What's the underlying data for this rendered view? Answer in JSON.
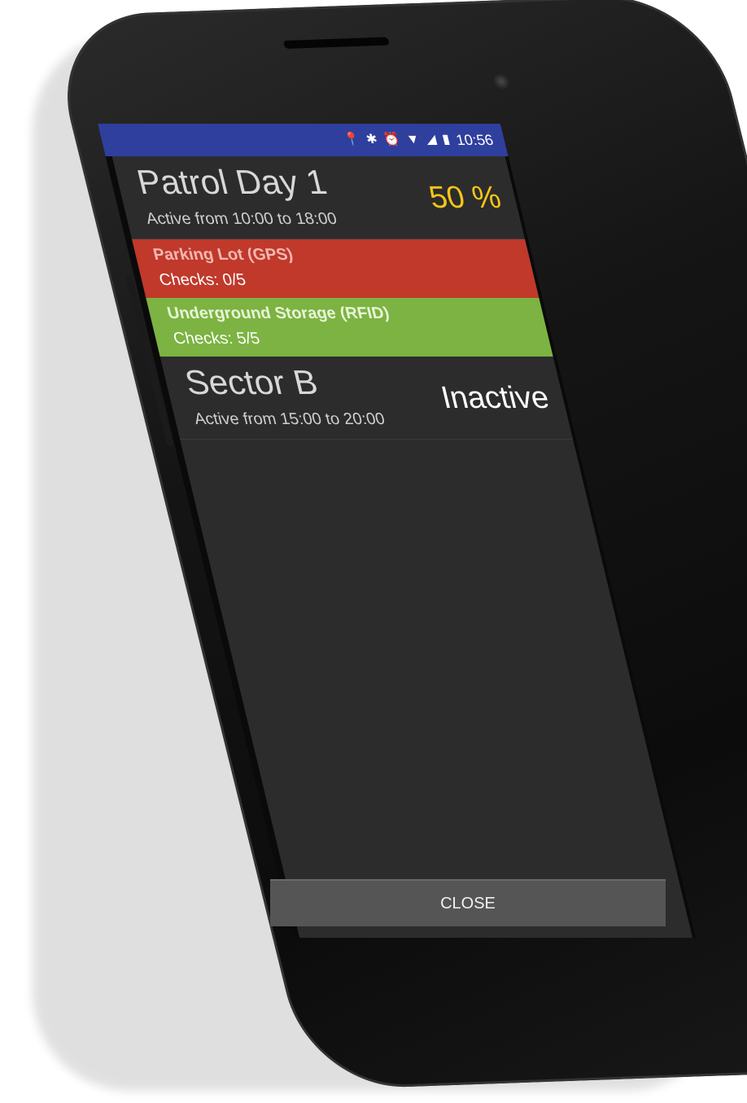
{
  "status_bar": {
    "time": "10:56",
    "icons": [
      "location-icon",
      "bluetooth-icon",
      "alarm-icon",
      "wifi-icon",
      "signal-icon",
      "battery-icon"
    ]
  },
  "patrols": [
    {
      "title": "Patrol Day 1",
      "subtitle": "Active from 10:00 to 18:00",
      "status": "50 %",
      "status_color": "#f5c518",
      "checkpoints": [
        {
          "title": "Parking Lot (GPS)",
          "checks": "Checks: 0/5",
          "color": "#c0392b",
          "title_color": "#f2b8b2"
        },
        {
          "title": "Underground Storage (RFID)",
          "checks": "Checks: 5/5",
          "color": "#7cb342",
          "title_color": "#e8f5d8"
        }
      ]
    },
    {
      "title": "Sector B",
      "subtitle": "Active from 15:00 to 20:00",
      "status": "Inactive",
      "status_color": "#ffffff",
      "checkpoints": []
    }
  ],
  "close_button": "CLOSE"
}
